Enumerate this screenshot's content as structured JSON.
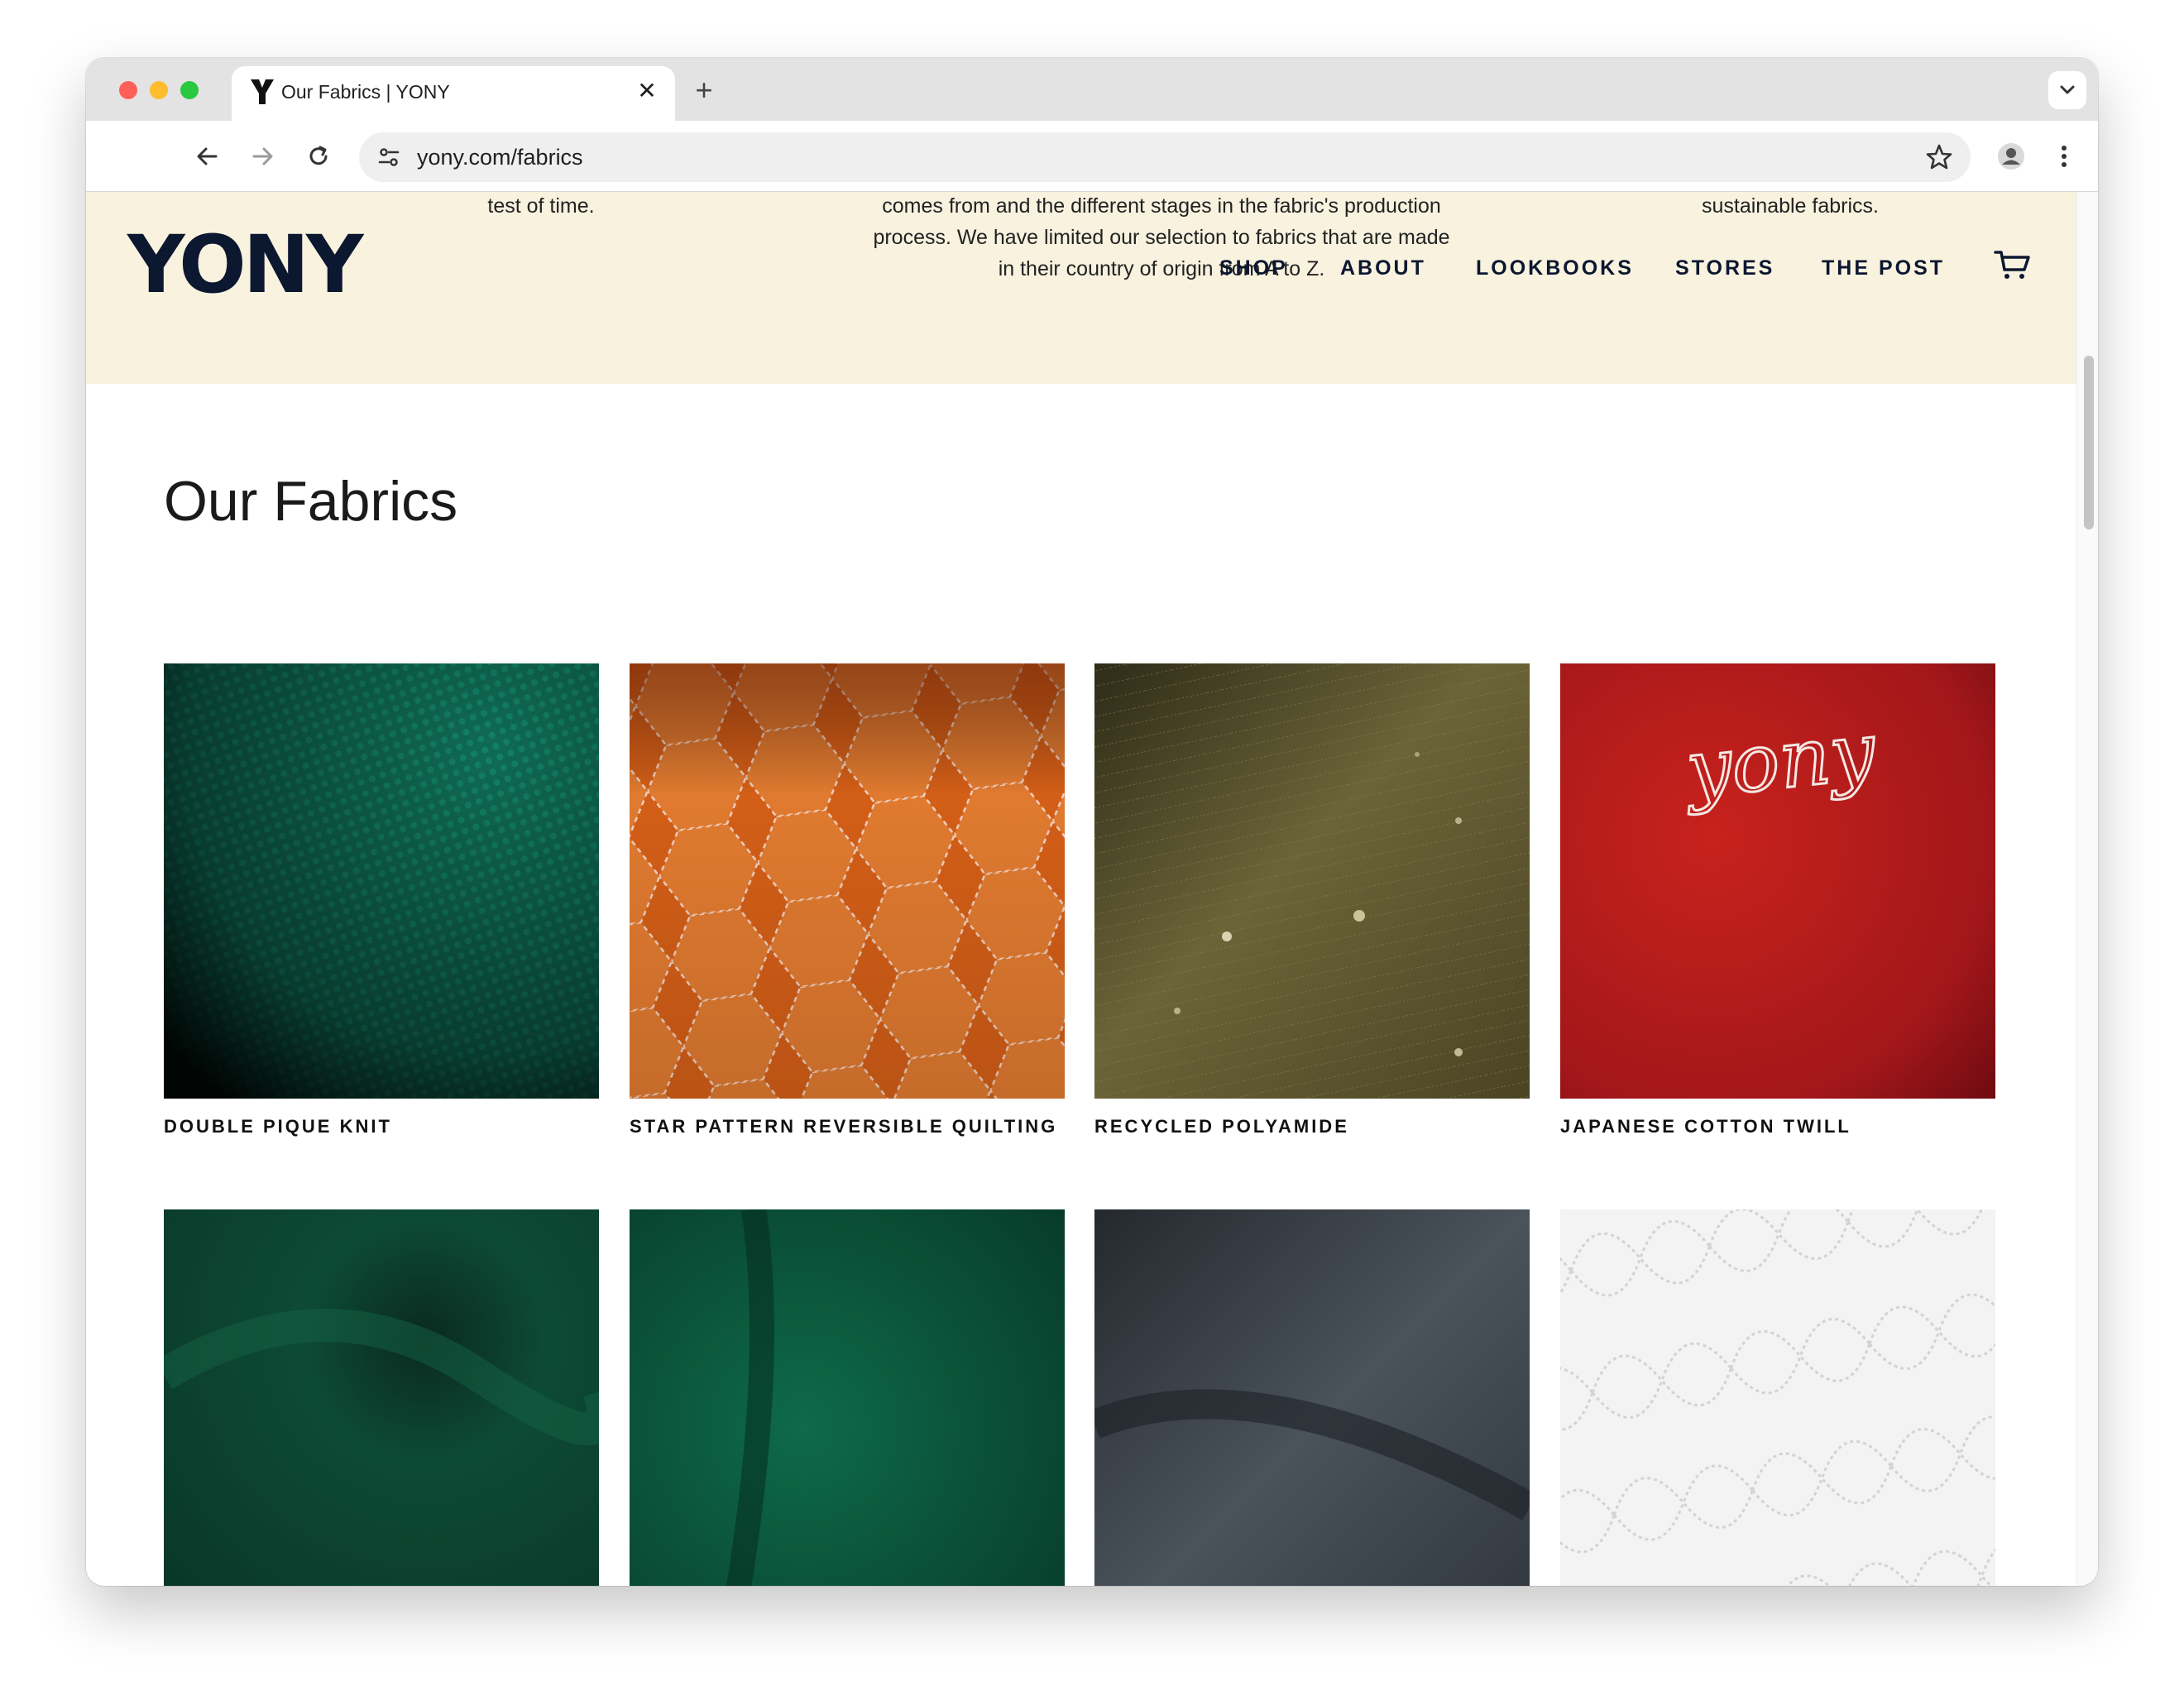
{
  "browser": {
    "tab_title": "Our Fabrics | YONY",
    "url": "yony.com/fabrics"
  },
  "intro": {
    "col1": "carefully selected to create a certain look that will stand the test of time.",
    "col2": "from, however, few of them actually disclose where the fiber comes from and the different stages in the fabric's production process. We have limited our selection to fabrics that are made in their country of origin from A to Z.",
    "col3": "Presently, our organic cotton twill, denim and wool are all sustainable fabrics."
  },
  "header": {
    "logo": "YONY",
    "nav": {
      "shop": "SHOP",
      "about": "ABOUT",
      "lookbooks": "LOOKBOOKS",
      "stores": "STORES",
      "the_post": "THE POST"
    }
  },
  "main": {
    "title": "Our Fabrics",
    "fabrics": [
      {
        "name": "DOUBLE PIQUE KNIT",
        "color": "#0f6b55"
      },
      {
        "name": "STAR PATTERN REVERSIBLE QUILTING",
        "color": "#d35e17"
      },
      {
        "name": "RECYCLED POLYAMIDE",
        "color": "#5a5430"
      },
      {
        "name": "JAPANESE COTTON TWILL",
        "color": "#b81f1c",
        "embroidery": "yony"
      },
      {
        "name": "",
        "color": "#0d4a35"
      },
      {
        "name": "",
        "color": "#0c5a40"
      },
      {
        "name": "",
        "color": "#363d44"
      },
      {
        "name": "",
        "color": "#eeeeee"
      }
    ]
  }
}
